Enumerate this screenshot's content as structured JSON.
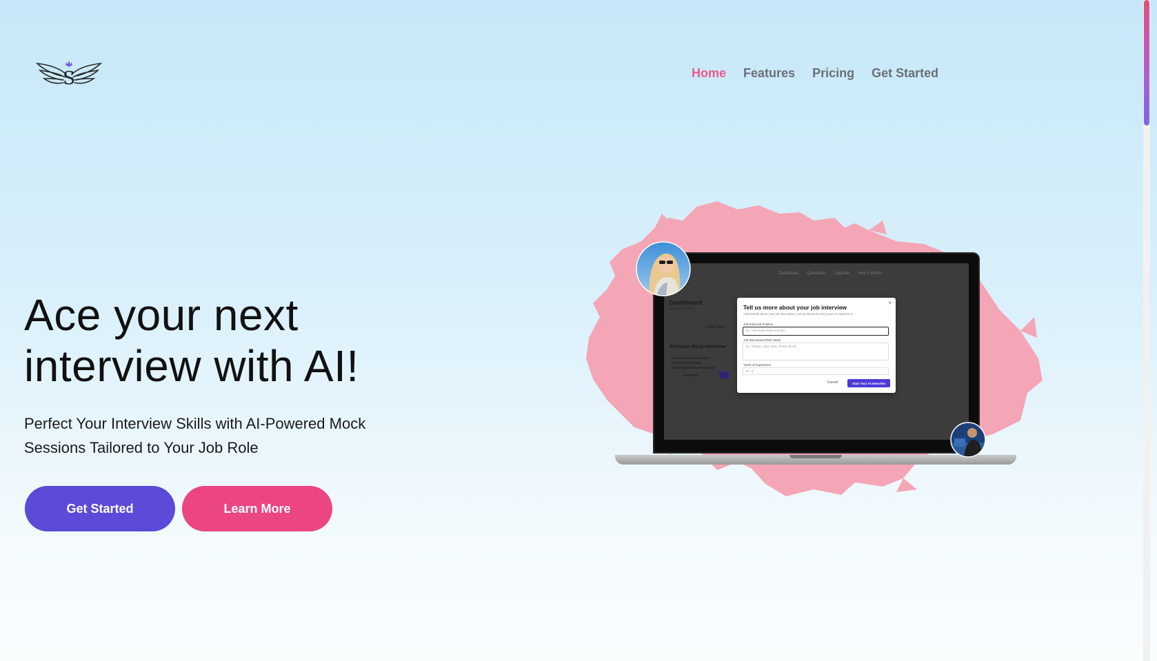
{
  "header": {
    "logo_icon": "winged-s-logo-icon",
    "nav": [
      {
        "label": "Home",
        "active": true
      },
      {
        "label": "Features",
        "active": false
      },
      {
        "label": "Pricing",
        "active": false
      },
      {
        "label": "Get Started",
        "active": false
      }
    ]
  },
  "hero": {
    "title_line1": "Ace your next",
    "title_line2": "interview with AI!",
    "subtitle_line1": "Perfect Your Interview Skills with AI-Powered Mock",
    "subtitle_line2": "Sessions Tailored to Your Job Role",
    "primary_button": "Get Started",
    "secondary_button": "Learn More"
  },
  "mockup": {
    "nav": [
      "Dashboard",
      "Questions",
      "Upgrade",
      "How it Works"
    ],
    "dashboard_title": "Dashboard",
    "dashboard_sub": "Create and Start",
    "add_new": "+ Add New",
    "previous_title": "Previous Mock Interview",
    "feedback_label": "Feedback",
    "modal": {
      "title": "Tell us more about your job interview",
      "description": "Add Details about your job description, job position/role and years of experience",
      "position_label": "Job Role/Job Position",
      "position_placeholder": "Ex. Full Stack Data Scientist",
      "stack_label": "Job Description/Tech Stack",
      "stack_placeholder": "Ex. Python, Java, SQL, React.JS etc",
      "experience_label": "Years of Experience",
      "experience_placeholder": "Ex. 5",
      "cancel": "Cancel",
      "start": "Start Your AI Interview"
    }
  },
  "colors": {
    "accent_primary": "#5b4bd8",
    "accent_secondary": "#eb4582",
    "nav_active": "#f0568c",
    "splash": "#f4a6b6"
  }
}
